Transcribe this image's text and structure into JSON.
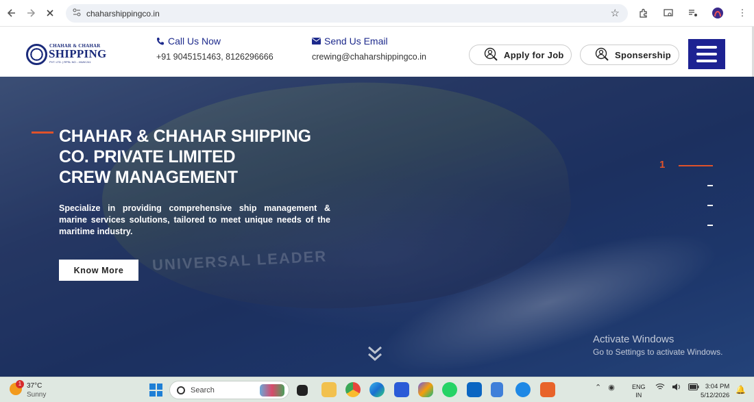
{
  "browser": {
    "url": "chaharshippingco.in"
  },
  "header": {
    "logo": {
      "top_text": "CHAHAR & CHAHAR",
      "main_text": "SHIPPING",
      "sub_text": "PVT. LTD. | RPSL NO. - MUM 241"
    },
    "call": {
      "label": "Call Us Now",
      "value": "+91 9045151463, 8126296666"
    },
    "email": {
      "label": "Send Us Email",
      "value": "crewing@chaharshippingco.in"
    },
    "apply_label": "Apply for Job",
    "sponsorship_label": "Sponsership",
    "brand_color": "#1d2292"
  },
  "hero": {
    "title_lines": [
      "CHAHAR & CHAHAR SHIPPING",
      "CO. PRIVATE LIMITED",
      "CREW MANAGEMENT"
    ],
    "description": "Specialize in providing comprehensive ship management & marine services solutions, tailored to meet unique needs of the maritime industry.",
    "cta_label": "Know More",
    "slide_current": "1",
    "ship_text": "UNIVERSAL LEADER",
    "accent_color": "#e0522a"
  },
  "watermark": {
    "line1": "Activate Windows",
    "line2": "Go to Settings to activate Windows."
  },
  "taskbar": {
    "weather": {
      "badge": "1",
      "temp": "37°C",
      "condition": "Sunny"
    },
    "search_placeholder": "Search",
    "lang": {
      "line1": "ENG",
      "line2": "IN"
    },
    "time": "3:04 PM",
    "date": "5/12/2026"
  }
}
